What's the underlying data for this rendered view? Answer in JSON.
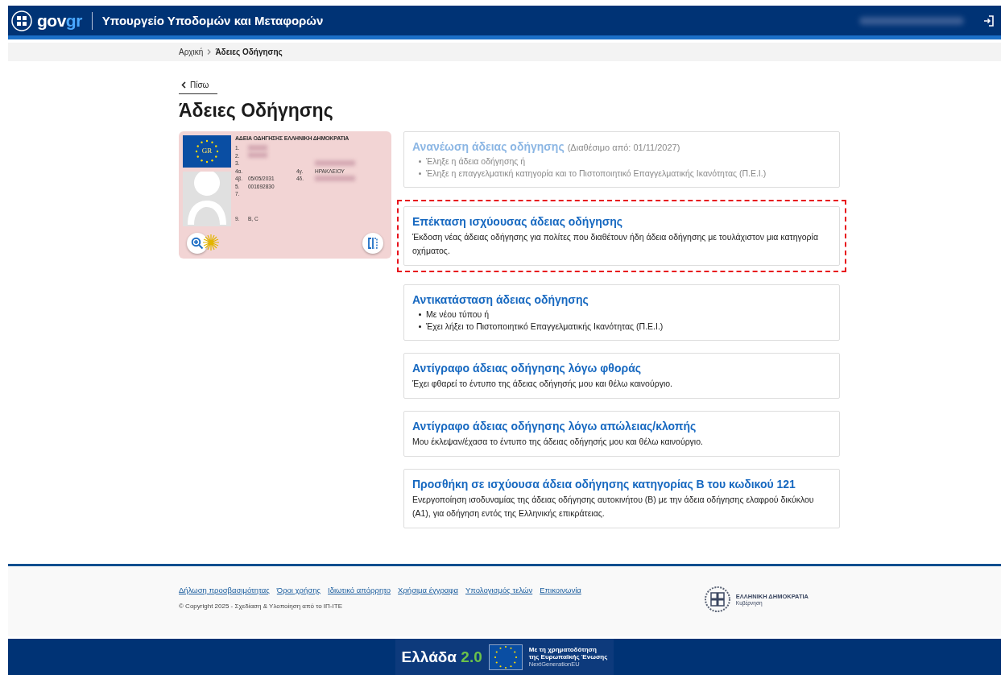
{
  "header": {
    "logo": "gov",
    "logo_accent": "gr",
    "title": "Υπουργείο Υποδομών και Μεταφορών"
  },
  "breadcrumb": [
    {
      "label": "Αρχική",
      "current": false
    },
    {
      "label": "Άδειες Οδήγησης",
      "current": true
    }
  ],
  "back": "Πίσω",
  "page_title": "Άδειες Οδήγησης",
  "license_card": {
    "heading": "ΑΔΕΙΑ ΟΔΗΓΗΣΗΣ ΕΛΛΗΝΙΚΗ ΔΗΜΟΚΡΑΤΙΑ",
    "flag_text": "GR",
    "rows": [
      {
        "label": "1.",
        "masked": true
      },
      {
        "label": "2.",
        "masked": true
      },
      {
        "label": "3.",
        "masked2": true
      },
      {
        "label": "4α.",
        "label2": "4γ.",
        "value2": "ΗΡΑΚΛΕΙΟΥ"
      },
      {
        "label": "4β.",
        "value": "05/05/2031",
        "label2": "4δ.",
        "masked2": true
      },
      {
        "label": "5.",
        "value": "001692830"
      },
      {
        "label": "7."
      }
    ],
    "categories_label": "9.",
    "categories": "B, C"
  },
  "options": [
    {
      "kind": "bullets",
      "title": "Ανανέωση άδειας οδήγησης",
      "note": "(Διαθέσιμο από: 01/11/2027)",
      "disabled": true,
      "highlighted": false,
      "items": [
        "Έληξε η άδεια οδήγησης ή",
        "Έληξε η επαγγελματική κατηγορία και το Πιστοποιητικό Επαγγελματικής Ικανότητας (Π.Ε.Ι.)"
      ]
    },
    {
      "kind": "text",
      "title": "Επέκταση ισχύουσας άδειας οδήγησης",
      "disabled": false,
      "highlighted": true,
      "description": "Έκδοση νέας άδειας οδήγησης για πολίτες που διαθέτουν ήδη άδεια οδήγησης με τουλάχιστον μια κατηγορία οχήματος."
    },
    {
      "kind": "bullets",
      "title": "Αντικατάσταση άδειας οδήγησης",
      "disabled": false,
      "highlighted": false,
      "items": [
        "Με νέου τύπου ή",
        "Έχει λήξει το Πιστοποιητικό Επαγγελματικής Ικανότητας (Π.Ε.Ι.)"
      ]
    },
    {
      "kind": "text",
      "title": "Αντίγραφο άδειας οδήγησης λόγω φθοράς",
      "disabled": false,
      "highlighted": false,
      "description": "Έχει φθαρεί το έντυπο της άδειας οδήγησής μου και θέλω καινούργιο."
    },
    {
      "kind": "text",
      "title": "Αντίγραφο άδειας οδήγησης λόγω απώλειας/κλοπής",
      "disabled": false,
      "highlighted": false,
      "description": "Μου έκλεψαν/έχασα το έντυπο της άδειας οδήγησής μου και θέλω καινούργιο."
    },
    {
      "kind": "text",
      "title": "Προσθήκη σε ισχύουσα άδεια οδήγησης κατηγορίας Β του κωδικού 121",
      "disabled": false,
      "highlighted": false,
      "description": "Ενεργοποίηση ισοδυναμίας της άδειας οδήγησης αυτοκινήτου (Β) με την άδεια οδήγησης ελαφρού δικύκλου (Α1), για οδήγηση εντός της Ελληνικής επικράτειας."
    }
  ],
  "footer": {
    "links": [
      "Δήλωση προσβασιμότητας",
      "Όροι χρήσης",
      "Ιδιωτικό απόρρητο",
      "Χρήσιμα έγγραφα",
      "Υπολογισμός τελών",
      "Επικοινωνία"
    ],
    "copyright": "© Copyright 2025 - Σχεδίαση & Υλοποίηση από το ΙΠ-ΙΤΕ",
    "gov_name": "ΕΛΛΗΝΙΚΗ ΔΗΜΟΚΡΑΤΙΑ",
    "gov_sub": "Κυβέρνηση"
  },
  "funding": {
    "greece": "Ελλάδα",
    "greece_version": "2.0",
    "eu_line1": "Με τη χρηματοδότηση",
    "eu_line2": "της Ευρωπαϊκής Ένωσης",
    "eu_line3": "NextGenerationEU"
  }
}
